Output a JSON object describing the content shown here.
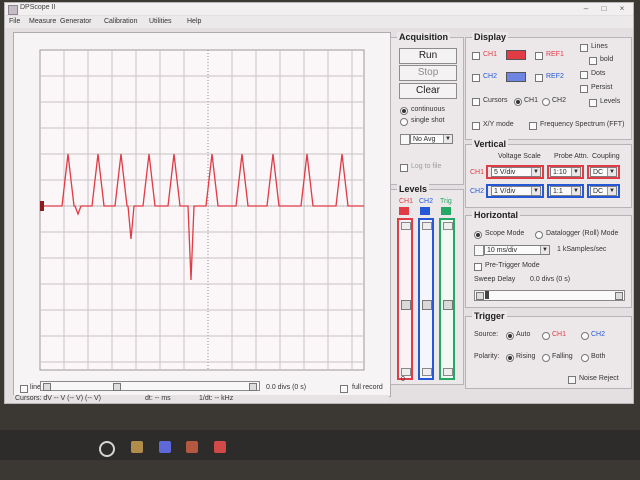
{
  "window": {
    "title": "DPScope II",
    "menu": [
      "File",
      "Measure",
      "Generator",
      "Calibration",
      "Utilities",
      "Help"
    ]
  },
  "scope": {
    "line_checkbox": "line",
    "offset_label": "0.0 divs (0 s)",
    "full_record": "full record",
    "cursors_text": "Cursors: dV -- V (-- V) (-- V)",
    "dt_text": "dt: -- ms",
    "freq_text": "1/dt: -- kHz"
  },
  "acquisition": {
    "title": "Acquisition",
    "run": "Run",
    "stop": "Stop",
    "clear": "Clear",
    "continuous": "continuous",
    "single_shot": "single shot",
    "avg": "No Avg",
    "log_to_file": "Log to file"
  },
  "levels": {
    "title": "Levels",
    "ch1": "CH1",
    "ch2": "CH2",
    "trig": "Trig",
    "bottom_value": "0"
  },
  "display": {
    "title": "Display",
    "ch1": "CH1",
    "ch2": "CH2",
    "ref1": "REF1",
    "ref2": "REF2",
    "lines": "Lines",
    "bold": "bold",
    "dots": "Dots",
    "persist": "Persist",
    "levels": "Levels",
    "cursors": "Cursors",
    "cursor_ch1": "CH1",
    "cursor_ch2": "CH2",
    "xy_mode": "X/Y mode",
    "fft": "Frequency Spectrum (FFT)"
  },
  "vertical": {
    "title": "Vertical",
    "col_voltage": "Voltage Scale",
    "col_probe": "Probe Attn.",
    "col_coupling": "Coupling",
    "ch1_label": "CH1",
    "ch2_label": "CH2",
    "ch1_scale": "5 V/div",
    "ch2_scale": "1 V/div",
    "ch1_probe": "1:10",
    "ch2_probe": "1:1",
    "ch1_coupling": "DC",
    "ch2_coupling": "DC"
  },
  "horizontal": {
    "title": "Horizontal",
    "scope_mode": "Scope Mode",
    "datalogger_mode": "Datalogger (Roll) Mode",
    "timebase": "10 ms/div",
    "sample_rate": "1 kSamples/sec",
    "pretrigger": "Pre-Trigger Mode",
    "sweep_delay": "Sweep Delay",
    "sweep_value": "0.0 divs (0 s)"
  },
  "trigger": {
    "title": "Trigger",
    "source_label": "Source:",
    "auto": "Auto",
    "ch1": "CH1",
    "ch2": "CH2",
    "polarity_label": "Polarity:",
    "rising": "Rising",
    "falling": "Falling",
    "both": "Both",
    "noise_reject": "Noise Reject"
  },
  "colors": {
    "ch1": "#e13b45",
    "ch2": "#2458d6",
    "trig": "#23a866"
  }
}
